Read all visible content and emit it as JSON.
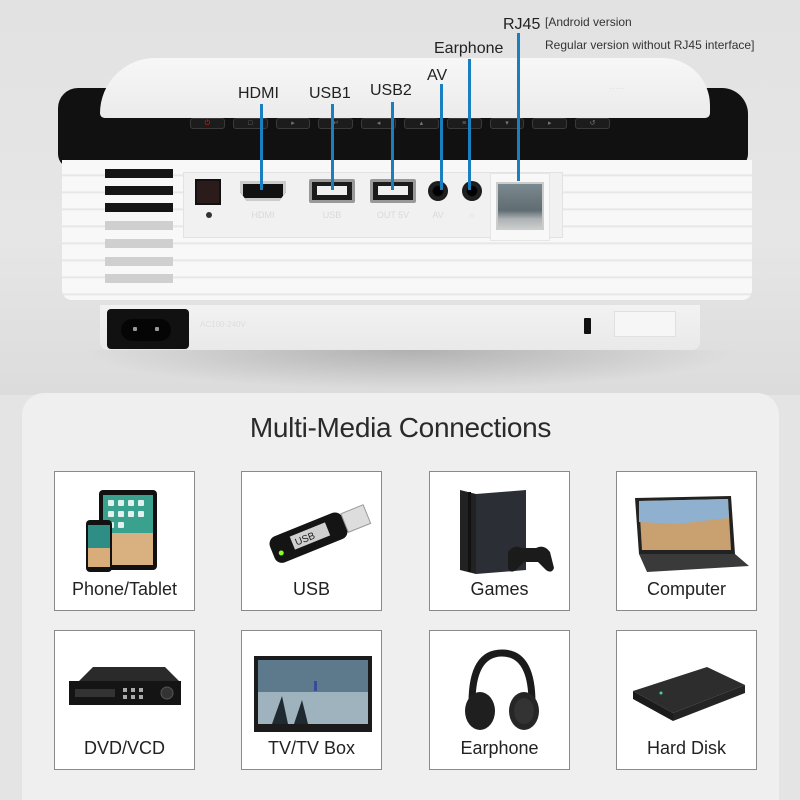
{
  "callouts": {
    "hdmi": "HDMI",
    "usb1": "USB1",
    "usb2": "USB2",
    "av": "AV",
    "earphone": "Earphone",
    "rj45": "RJ45",
    "rj45_note_line1": "[Android version",
    "rj45_note_line2": "Regular version without RJ45 interface]",
    "line_color": "#1a7fc1"
  },
  "device": {
    "port_captions": {
      "hdmi": "HDMI",
      "usb": "USB",
      "usb2": "OUT 5V",
      "av": "AV",
      "earphone": "∩"
    },
    "voltage_label": "AC100-240V",
    "button_glyphs": [
      "⏻",
      "□",
      "▸",
      "↵",
      "◂",
      "▴",
      "≡",
      "▾",
      "▸",
      "↺"
    ]
  },
  "panel": {
    "title": "Multi-Media Connections",
    "cards": [
      {
        "label": "Phone/Tablet",
        "icon": "phone-tablet-icon"
      },
      {
        "label": "USB",
        "icon": "usb-stick-icon"
      },
      {
        "label": "Games",
        "icon": "game-console-icon"
      },
      {
        "label": "Computer",
        "icon": "laptop-icon"
      },
      {
        "label": "DVD/VCD",
        "icon": "dvd-player-icon"
      },
      {
        "label": "TV/TV Box",
        "icon": "tv-icon"
      },
      {
        "label": "Earphone",
        "icon": "headphones-icon"
      },
      {
        "label": "Hard Disk",
        "icon": "hard-disk-icon"
      }
    ]
  }
}
